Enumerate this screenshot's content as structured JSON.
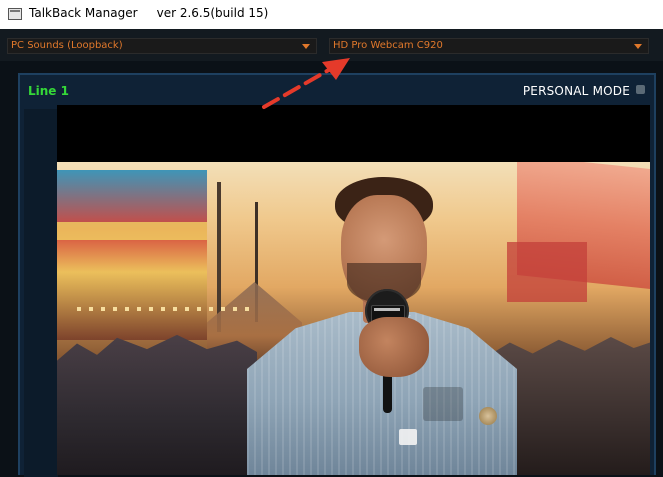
{
  "window": {
    "title": "TalkBack Manager     ver 2.6.5(build 15)"
  },
  "toolbar": {
    "audio_source": {
      "selected": "PC Sounds (Loopback)"
    },
    "video_source": {
      "selected": "HD Pro Webcam C920"
    }
  },
  "line_panel": {
    "title": "Line 1",
    "mode_label": "PERSONAL MODE"
  },
  "colors": {
    "dropdown_text": "#e0782b",
    "line_title": "#35d838",
    "panel_bg": "#0f2236",
    "panel_border": "#1e4060",
    "annotation_arrow": "#e53a2a"
  },
  "icons": {
    "app": "window-icon",
    "dropdown": "chevron-down-icon",
    "mode_indicator": "square-indicator-icon",
    "annotation": "arrow-annotation-icon"
  }
}
